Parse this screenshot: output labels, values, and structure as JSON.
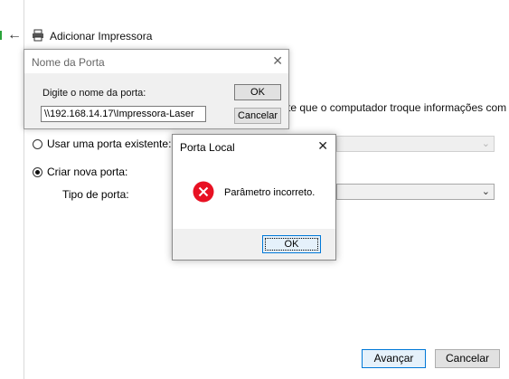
{
  "wizard": {
    "title": "Adicionar Impressora",
    "description_fragment": "te que o computador troque informações com",
    "options": {
      "existing_port_label": "Usar uma porta existente:",
      "new_port_label": "Criar nova porta:",
      "selected": "new_port"
    },
    "port_type_label": "Tipo de porta:",
    "footer": {
      "next_label": "Avançar",
      "cancel_label": "Cancelar"
    }
  },
  "port_name_dialog": {
    "title": "Nome da Porta",
    "prompt": "Digite o nome da porta:",
    "port_value": "\\\\192.168.14.17\\Impressora-Laser",
    "ok_label": "OK",
    "cancel_label": "Cancelar"
  },
  "local_port_dialog": {
    "title": "Porta Local",
    "message": "Parâmetro incorreto.",
    "ok_label": "OK"
  },
  "icons": {
    "back": "back-arrow-icon",
    "printer": "printer-icon",
    "close": "close-icon",
    "error": "error-icon",
    "chevron": "chevron-down-icon"
  },
  "colors": {
    "accent": "#0078d7",
    "error_red": "#e81123",
    "dialog_body": "#f0f0f0"
  }
}
